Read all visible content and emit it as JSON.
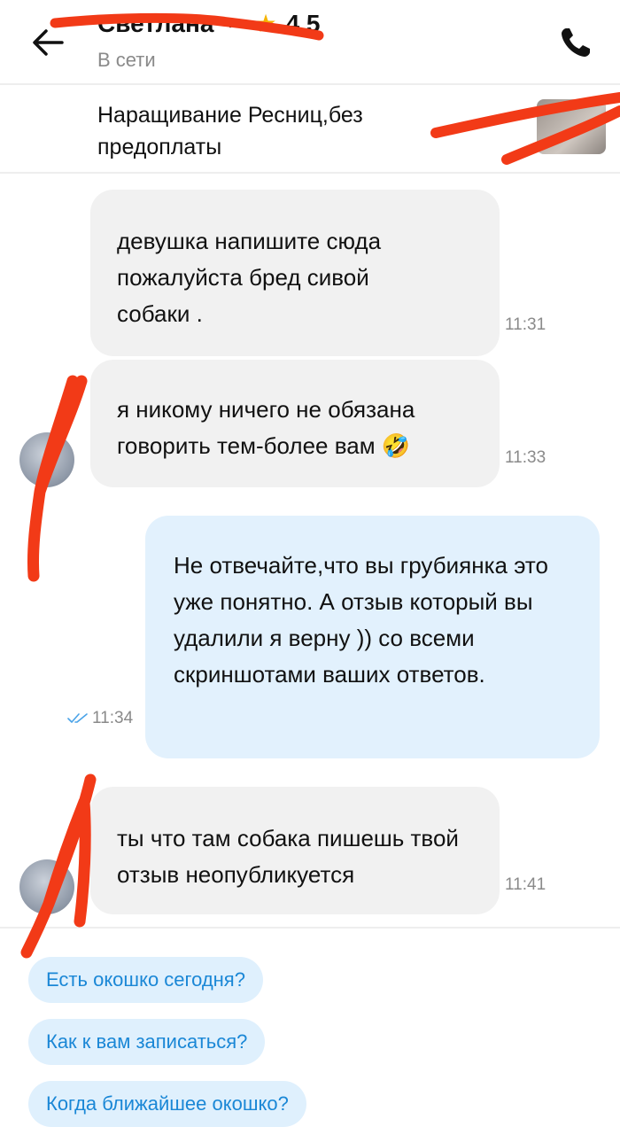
{
  "header": {
    "name": "Светлана",
    "rating_star": "★",
    "rating": "4,5",
    "status": "В сети"
  },
  "ad": {
    "title": "Наращивание Ресниц,без предоплаты"
  },
  "messages": [
    {
      "text": "девушка напишите сюда пожалуйста бред сивой собаки .",
      "time": "11:31",
      "direction": "in"
    },
    {
      "text": "я никому ничего не обязана говорить тем-более вам 🤣",
      "time": "11:33",
      "direction": "in"
    },
    {
      "text": "Не отвечайте,что вы грубиянка это уже понятно. А отзыв который вы удалили я верну )) со всеми скриншотами ваших ответов.",
      "time": "11:34",
      "direction": "out"
    },
    {
      "text": "ты что там собака пишешь твой отзыв неопубликуется",
      "time": "11:41",
      "direction": "in"
    }
  ],
  "quick_replies": [
    "Есть окошко сегодня?",
    "Как к вам записаться?",
    "Когда ближайшее окошко?"
  ],
  "colors": {
    "incoming_bubble": "#f1f1f1",
    "outgoing_bubble": "#e2f1fd",
    "chip_text": "#1a87d6",
    "star": "#f6b400",
    "censor_red": "#f23a17"
  }
}
